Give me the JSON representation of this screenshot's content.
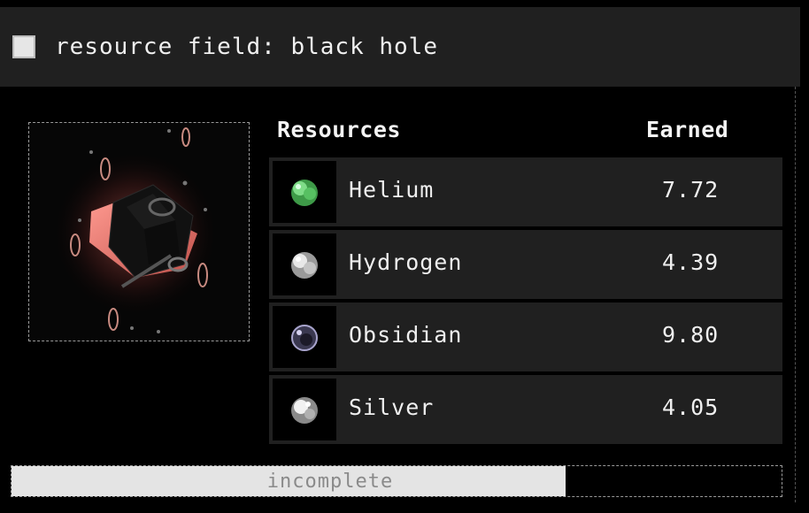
{
  "header": {
    "title": "resource field: black hole",
    "checkbox_checked": false
  },
  "table": {
    "col_resources": "Resources",
    "col_earned": "Earned",
    "rows": [
      {
        "name": "Helium",
        "earned": "7.72",
        "icon": "helium-orb-icon",
        "color": "#4fb85a"
      },
      {
        "name": "Hydrogen",
        "earned": "4.39",
        "icon": "hydrogen-orb-icon",
        "color": "#d8d8d8"
      },
      {
        "name": "Obsidian",
        "earned": "9.80",
        "icon": "obsidian-orb-icon",
        "color": "#6e6a8a"
      },
      {
        "name": "Silver",
        "earned": "4.05",
        "icon": "silver-orb-icon",
        "color": "#cfcfcf"
      }
    ]
  },
  "progress": {
    "label": "incomplete",
    "fraction": 0.72
  },
  "colors": {
    "background": "#000000",
    "panel": "#202020",
    "accent": "#e0706a"
  }
}
